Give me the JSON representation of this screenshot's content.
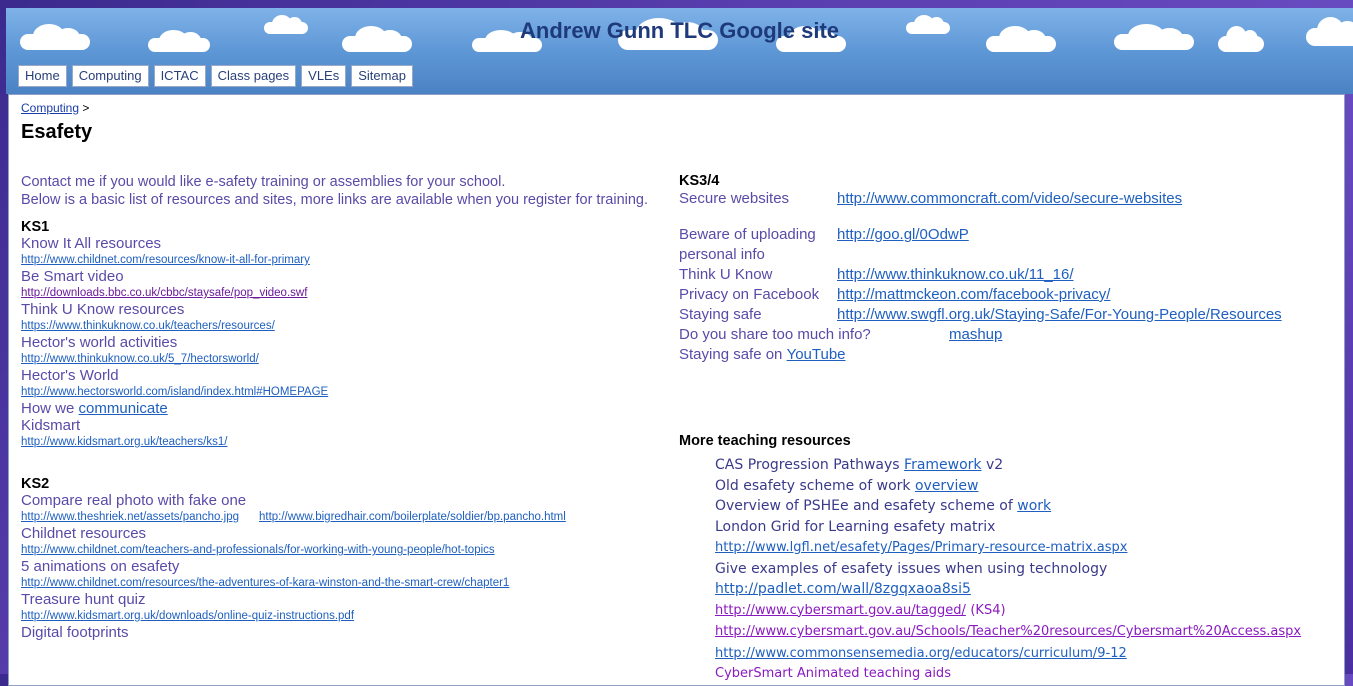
{
  "site_title": "Andrew Gunn TLC Google site",
  "nav": [
    "Home",
    "Computing",
    "ICTAC",
    "Class pages",
    "VLEs",
    "Sitemap"
  ],
  "breadcrumb": {
    "parent": "Computing",
    "separator": ">"
  },
  "page_title": "Esafety",
  "intro": [
    "Contact me if you would like e-safety training or assemblies for your school.",
    "Below is a basic list of resources and sites, more links are available when you register for training."
  ],
  "ks1": {
    "heading": "KS1",
    "items": [
      {
        "title": "Know It All resources",
        "url": "http://www.childnet.com/resources/know-it-all-for-primary"
      },
      {
        "title": "Be Smart video",
        "url": "http://downloads.bbc.co.uk/cbbc/staysafe/pop_video.swf"
      },
      {
        "title": "Think U Know resources",
        "url": "https://www.thinkuknow.co.uk/teachers/resources/"
      },
      {
        "title": "Hector's world activities",
        "url": "http://www.thinkuknow.co.uk/5_7/hectorsworld/"
      },
      {
        "title": "Hector's World",
        "url": "http://www.hectorsworld.com/island/index.html#HOMEPAGE"
      }
    ],
    "communicate_prefix": "How we",
    "communicate_link": "communicate",
    "kidsmart_title": "Kidsmart",
    "kidsmart_url": "http://www.kidsmart.org.uk/teachers/ks1/"
  },
  "ks2": {
    "heading": "KS2",
    "photo_title": "Compare real photo with fake one",
    "photo_url1": "http://www.theshriek.net/assets/pancho.jpg",
    "photo_url2": "http://www.bigredhair.com/boilerplate/soldier/bp.pancho.html",
    "items": [
      {
        "title": "Childnet resources",
        "url": "http://www.childnet.com/teachers-and-professionals/for-working-with-young-people/hot-topics"
      },
      {
        "title": "5 animations on esafety",
        "url": "http://www.childnet.com/resources/the-adventures-of-kara-winston-and-the-smart-crew/chapter1"
      },
      {
        "title": "Treasure hunt quiz",
        "url": "http://www.kidsmart.org.uk/downloads/online-quiz-instructions.pdf"
      }
    ],
    "last_title": "Digital footprints"
  },
  "ks34": {
    "heading": "KS3/4",
    "secure_key": "Secure websites",
    "secure_url": "http://www.commoncraft.com/video/secure-websites",
    "beware_key_1": "Beware of uploading",
    "beware_key_2": "personal info",
    "beware_url": "http://goo.gl/0OdwP",
    "think_key": "Think U Know",
    "think_url": "http://www.thinkuknow.co.uk/11_16/",
    "privacy_key": "Privacy on Facebook",
    "privacy_url": "http://mattmckeon.com/facebook-privacy/",
    "staying_key": "Staying safe",
    "staying_url": "http://www.swgfl.org.uk/Staying-Safe/For-Young-People/Resources",
    "share_text": "Do you share too much info?",
    "share_link": "mashup",
    "youtube_prefix": "Staying safe on",
    "youtube_link": "YouTube"
  },
  "more": {
    "heading": "More teaching resources",
    "cas_prefix": "CAS Progression Pathways",
    "cas_link": "Framework",
    "cas_suffix": "v2",
    "old_prefix": "Old esafety scheme of work",
    "old_link": "overview",
    "pshe_prefix": "Overview of PSHEe and esafety scheme of",
    "pshe_link": "work",
    "lgfl_title": "London Grid for Learning esafety matrix",
    "lgfl_url": "http://www.lgfl.net/esafety/Pages/Primary-resource-matrix.aspx",
    "examples_title": "Give examples of esafety issues when using technology",
    "padlet_url": "http://padlet.com/wall/8zgqxaoa8si5",
    "cyber1_url": "http://www.cybersmart.gov.au/tagged/",
    "cyber1_tag": "(KS4)",
    "cyber2_url": "http://www.cybersmart.gov.au/Schools/Teacher%20resources/Cybersmart%20Access.aspx",
    "common_url": "http://www.commonsensemedia.org/educators/curriculum/9-12",
    "cyber_anim": "CyberSmart Animated teaching aids"
  }
}
